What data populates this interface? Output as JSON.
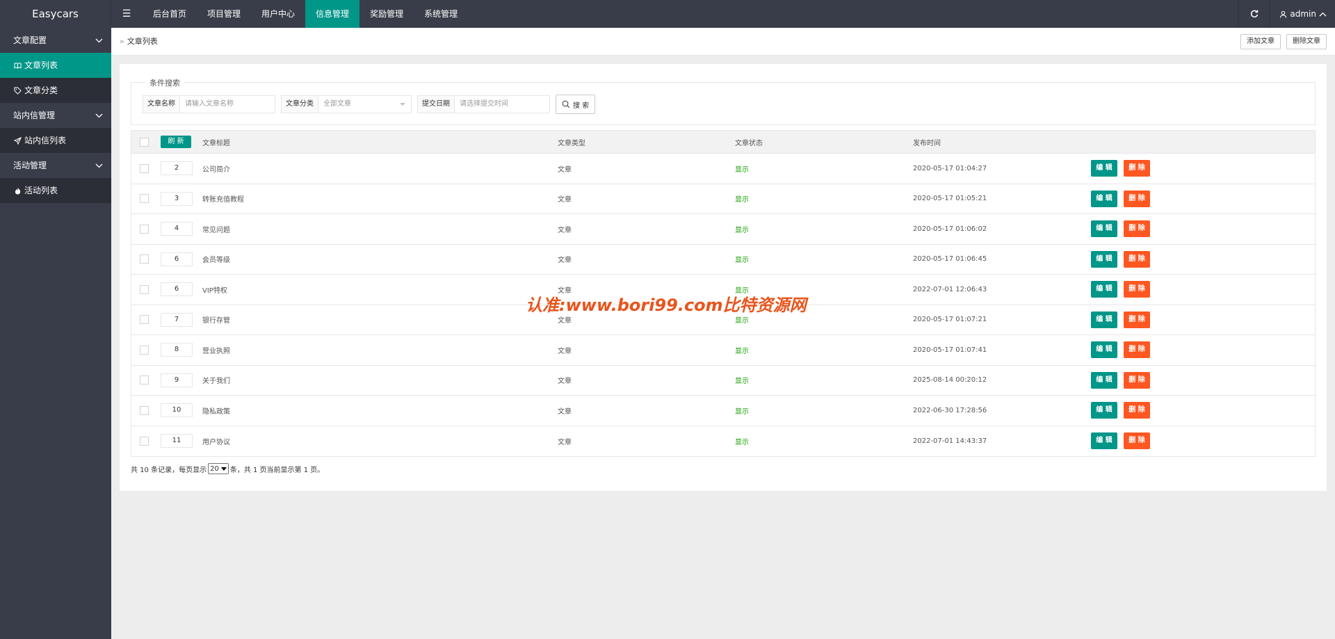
{
  "app": {
    "brand": "Easycars"
  },
  "topnav": {
    "toggle_icon": "hamburger-icon",
    "items": [
      {
        "label": "后台首页"
      },
      {
        "label": "项目管理"
      },
      {
        "label": "用户中心"
      },
      {
        "label": "信息管理",
        "active": true
      },
      {
        "label": "奖励管理"
      },
      {
        "label": "系统管理"
      }
    ],
    "user": "admin"
  },
  "sidebar": {
    "groups": [
      {
        "label": "文章配置",
        "items": [
          {
            "label": "文章列表",
            "icon": "book-icon",
            "active": true
          },
          {
            "label": "文章分类",
            "icon": "tag-icon"
          }
        ]
      },
      {
        "label": "站内信管理",
        "items": [
          {
            "label": "站内信列表",
            "icon": "send-icon"
          }
        ]
      },
      {
        "label": "活动管理",
        "items": [
          {
            "label": "活动列表",
            "icon": "flame-icon"
          }
        ]
      }
    ]
  },
  "breadcrumb": {
    "separator": "»",
    "current": "文章列表"
  },
  "header_actions": {
    "add": "添加文章",
    "delete": "删除文章"
  },
  "search": {
    "legend": "条件搜索",
    "name_label": "文章名称",
    "name_placeholder": "请输入文章名称",
    "category_label": "文章分类",
    "category_value": "全部文章",
    "date_label": "提交日期",
    "date_placeholder": "请选择提交时间",
    "button": "搜 索"
  },
  "table": {
    "refresh_label": "刷 新",
    "columns": [
      "文章标题",
      "文章类型",
      "文章状态",
      "发布时间"
    ],
    "edit_label": "编 辑",
    "delete_label": "删 除",
    "rows": [
      {
        "sort": "2",
        "title": "公司简介",
        "type": "文章",
        "status": "显示",
        "time": "2020-05-17 01:04:27"
      },
      {
        "sort": "3",
        "title": "转账充值教程",
        "type": "文章",
        "status": "显示",
        "time": "2020-05-17 01:05:21"
      },
      {
        "sort": "4",
        "title": "常见问题",
        "type": "文章",
        "status": "显示",
        "time": "2020-05-17 01:06:02"
      },
      {
        "sort": "6",
        "title": "会员等级",
        "type": "文章",
        "status": "显示",
        "time": "2020-05-17 01:06:45"
      },
      {
        "sort": "6",
        "title": "VIP特权",
        "type": "文章",
        "status": "显示",
        "time": "2022-07-01 12:06:43"
      },
      {
        "sort": "7",
        "title": "银行存管",
        "type": "文章",
        "status": "显示",
        "time": "2020-05-17 01:07:21"
      },
      {
        "sort": "8",
        "title": "营业执照",
        "type": "文章",
        "status": "显示",
        "time": "2020-05-17 01:07:41"
      },
      {
        "sort": "9",
        "title": "关于我们",
        "type": "文章",
        "status": "显示",
        "time": "2025-08-14 00:20:12"
      },
      {
        "sort": "10",
        "title": "隐私政策",
        "type": "文章",
        "status": "显示",
        "time": "2022-06-30 17:28:56"
      },
      {
        "sort": "11",
        "title": "用户协议",
        "type": "文章",
        "status": "显示",
        "time": "2022-07-01 14:43:37"
      }
    ]
  },
  "pager": {
    "prefix": "共 10 条记录，每页显示",
    "page_size": "20",
    "suffix": "条，共 1 页当前显示第 1 页。"
  },
  "watermark": "认准:www.bori99.com比特资源网",
  "colors": {
    "accent": "#009688",
    "danger": "#ff5722",
    "dark": "#393d49",
    "status_on": "#15a000"
  }
}
